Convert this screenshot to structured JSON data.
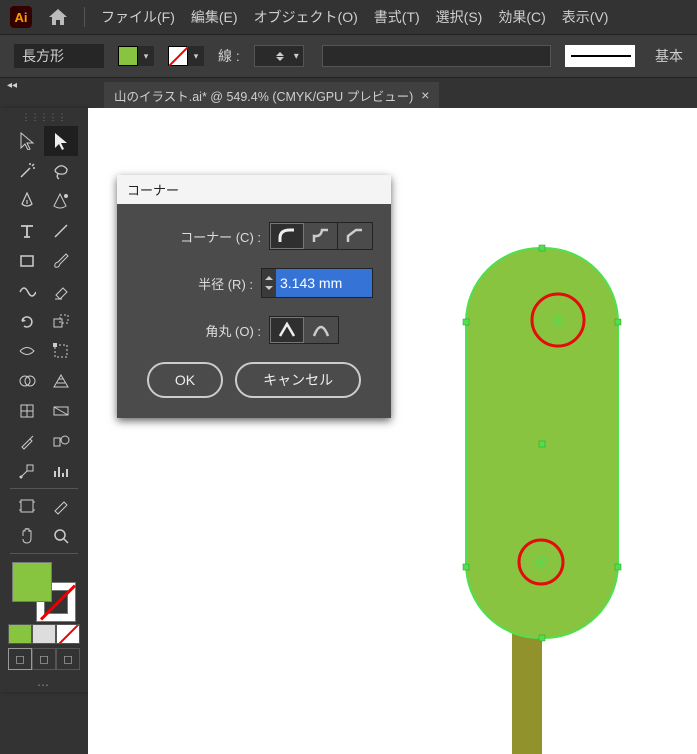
{
  "menu": {
    "file": "ファイル(F)",
    "edit": "編集(E)",
    "object": "オブジェクト(O)",
    "type": "書式(T)",
    "select": "選択(S)",
    "effect": "効果(C)",
    "view": "表示(V)"
  },
  "control": {
    "shape_name": "長方形",
    "stroke_label": "線 :",
    "basic_label": "基本"
  },
  "doc_tab": {
    "title": "山のイラスト.ai* @ 549.4% (CMYK/GPU プレビュー)",
    "close": "×"
  },
  "dialog": {
    "title": "コーナー",
    "corner_label": "コーナー (C) :",
    "radius_label": "半径 (R) :",
    "radius_value": "3.143 mm",
    "round_label": "角丸 (O) :",
    "ok": "OK",
    "cancel": "キャンセル"
  },
  "colors": {
    "fill": "#87c540",
    "shape_fill": "#88c43f",
    "shape_stroke": "#4fe04f",
    "stem": "#92922c",
    "circle": "#e40b0b"
  }
}
